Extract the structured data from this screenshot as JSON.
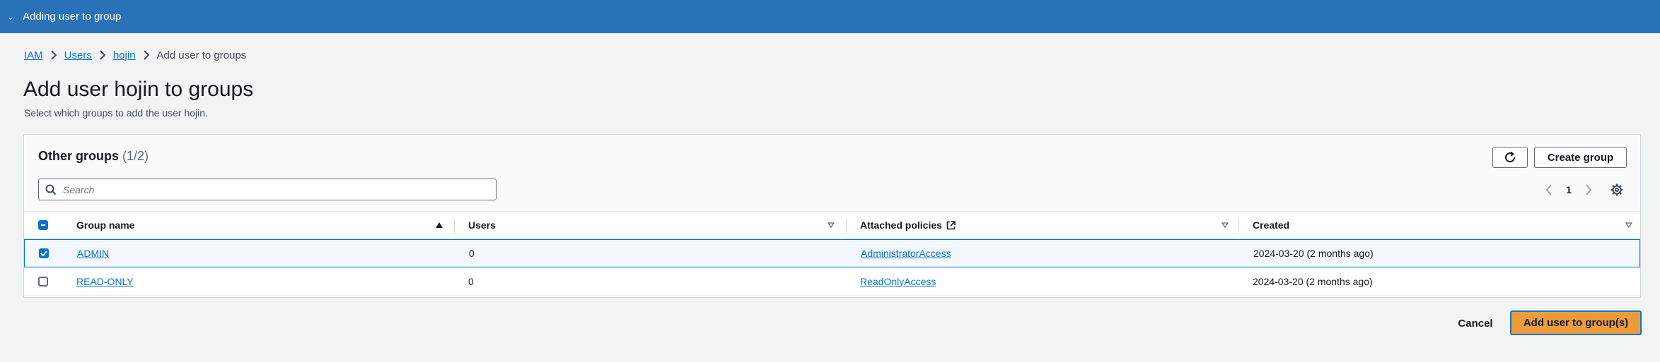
{
  "notification": {
    "text": "Adding user to group"
  },
  "breadcrumb": {
    "items": [
      "IAM",
      "Users",
      "hojin"
    ],
    "current": "Add user to groups"
  },
  "page": {
    "title": "Add user hojin to groups",
    "description": "Select which groups to add the user hojin."
  },
  "groups_panel": {
    "title": "Other groups",
    "count": "(1/2)",
    "create_button": "Create group",
    "refresh_icon": "refresh-icon",
    "search_placeholder": "Search",
    "page_number": "1",
    "columns": [
      "Group name",
      "Users",
      "Attached policies",
      "Created"
    ],
    "rows": [
      {
        "name": "ADMIN",
        "users": "0",
        "policy": "AdministratorAccess",
        "created": "2024-03-20 (2 months ago)",
        "selected": true
      },
      {
        "name": "READ-ONLY",
        "users": "0",
        "policy": "ReadOnlyAccess",
        "created": "2024-03-20 (2 months ago)",
        "selected": false
      }
    ]
  },
  "footer": {
    "cancel_label": "Cancel",
    "submit_label": "Add user to group(s)"
  },
  "colors": {
    "topbar": "#2a72b8",
    "link": "#0972d3",
    "primary": "#ec9c3a",
    "selected_row": "#f2f8fd"
  }
}
